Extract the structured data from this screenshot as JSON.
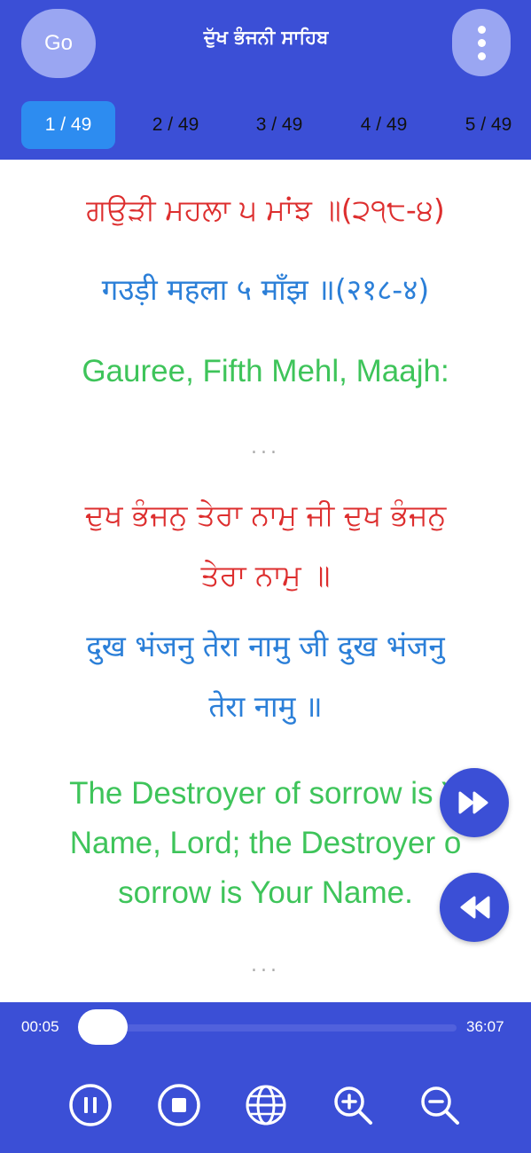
{
  "header": {
    "go_label": "Go",
    "title": "ਦੁੱਖ ਭੰਜਨੀ ਸਾਹਿਬ",
    "menu_icon": "more-vertical-icon"
  },
  "tabs": [
    {
      "label": "1 / 49",
      "active": true
    },
    {
      "label": "2 / 49",
      "active": false
    },
    {
      "label": "3 / 49",
      "active": false
    },
    {
      "label": "4 / 49",
      "active": false
    },
    {
      "label": "5 / 49",
      "active": false
    }
  ],
  "content": {
    "heading_gurmukhi": "ਗਉੜੀ ਮਹਲਾ ੫ ਮਾਂਝ ॥(੨੧੮-੪)",
    "heading_devanagari": "गउड़ी महला ५ माँझ ॥(२१८-४)",
    "heading_english": "Gauree, Fifth Mehl, Maajh:",
    "separator_1": "...",
    "verse_gurmukhi_1": "ਦੁਖ ਭੰਜਨੁ ਤੇਰਾ ਨਾਮੁ ਜੀ ਦੁਖ ਭੰਜਨੁ",
    "verse_gurmukhi_2": "ਤੇਰਾ ਨਾਮੁ ॥",
    "verse_devanagari_1": "दुख भंजनु तेरा नामु जी दुख भंजनु",
    "verse_devanagari_2": "तेरा नामु ॥",
    "verse_english_1": "The Destroyer of sorrow is Y",
    "verse_english_2": "Name, Lord; the Destroyer o",
    "verse_english_3": "sorrow is Your Name.",
    "separator_2": "..."
  },
  "player": {
    "current_time": "00:05",
    "total_time": "36:07",
    "progress_fraction": 0.0023
  },
  "colors": {
    "primary": "#3b4fd6",
    "active_tab": "#2d8cf0",
    "gurmukhi": "#dd2e2e",
    "devanagari": "#2b7fd8",
    "english": "#3ec45a"
  }
}
